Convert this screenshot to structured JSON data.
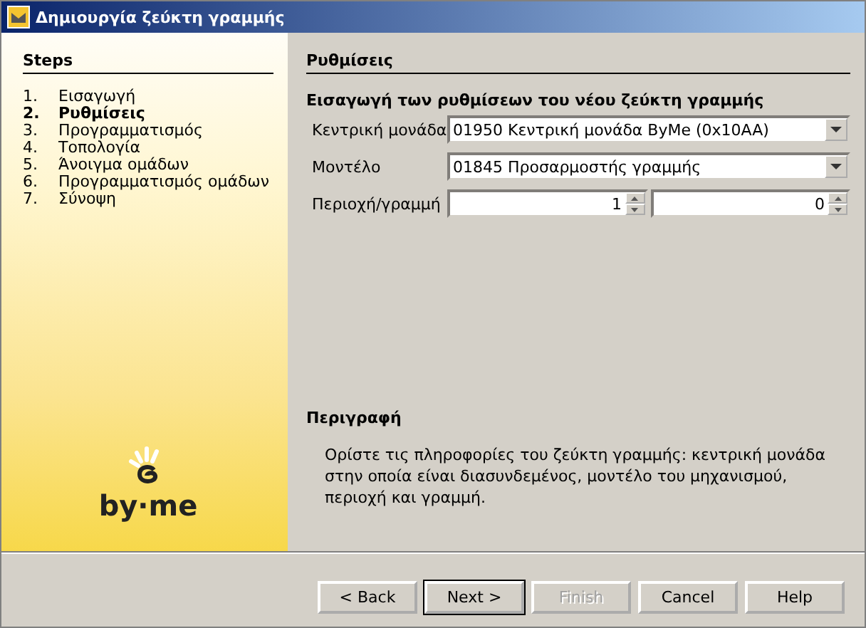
{
  "window": {
    "title": "Δημιουργία ζεύκτη γραμμής"
  },
  "steps": {
    "heading": "Steps",
    "items": [
      {
        "number": "1.",
        "label": "Εισαγωγή",
        "selected": false
      },
      {
        "number": "2.",
        "label": "Ρυθμίσεις",
        "selected": true
      },
      {
        "number": "3.",
        "label": "Προγραμματισμός",
        "selected": false
      },
      {
        "number": "4.",
        "label": "Τοπολογία",
        "selected": false
      },
      {
        "number": "5.",
        "label": "Άνοιγμα ομάδων",
        "selected": false
      },
      {
        "number": "6.",
        "label": "Προγραμματισμός ομάδων",
        "selected": false
      },
      {
        "number": "7.",
        "label": "Σύνοψη",
        "selected": false
      }
    ]
  },
  "logo": {
    "text": "by·me"
  },
  "panel": {
    "heading": "Ρυθμίσεις",
    "subheading": "Εισαγωγή των ρυθμίσεων του νέου ζεύκτη γραμμής",
    "fields": [
      {
        "kind": "dropdown",
        "label": "Κεντρική μονάδα",
        "value": "01950 Κεντρική μονάδα ByMe (0x10AA)"
      },
      {
        "kind": "dropdown",
        "label": "Μοντέλο",
        "value": "01845 Προσαρμοστής γραμμής"
      },
      {
        "kind": "spinners",
        "label": "Περιοχή/γραμμή",
        "values": [
          "1",
          "0"
        ]
      }
    ],
    "description_heading": "Περιγραφή",
    "description": "Ορίστε τις πληροφορίες του ζεύκτη γραμμής: κεντρική μονάδα στην οποία είναι διασυνδεμένος, μοντέλο του μηχανισμού, περιοχή και γραμμή."
  },
  "buttons": [
    {
      "label": "< Back",
      "disabled": false,
      "default": false
    },
    {
      "label": "Next >",
      "disabled": false,
      "default": true
    },
    {
      "label": "Finish",
      "disabled": true,
      "default": false
    },
    {
      "label": "Cancel",
      "disabled": false,
      "default": false
    },
    {
      "label": "Help",
      "disabled": false,
      "default": false
    }
  ]
}
